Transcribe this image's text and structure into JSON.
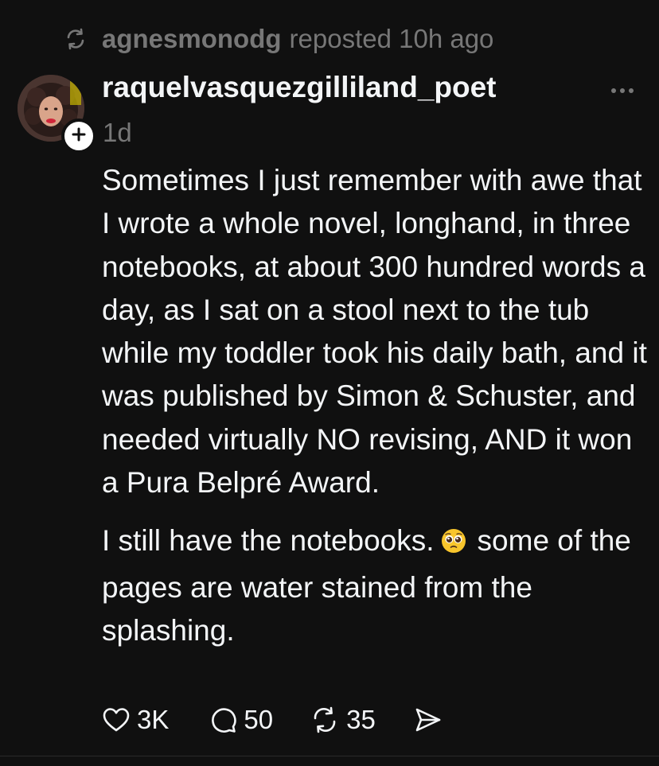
{
  "repost_header": {
    "reposter": "agnesmonodg",
    "text": "reposted 10h ago",
    "icon": "repost-icon"
  },
  "post": {
    "author": "raquelvasquezgilliland_poet",
    "time": "1d",
    "paragraphs": [
      "Sometimes I just remember with awe that I wrote a whole novel, longhand, in three notebooks, at about 300 hundred words a day, as I sat on a stool next to the tub while my toddler took his daily bath, and it was published by Simon & Schuster, and needed virtually NO revising, AND it won a Pura Belpré Award."
    ],
    "paragraph2_before_emoji": "I still have the notebooks.",
    "paragraph2_emoji": "pleading-face-emoji",
    "paragraph2_after_emoji": "some of the pages are water stained from the splashing."
  },
  "actions": {
    "likes": "3K",
    "replies": "50",
    "reposts": "35"
  },
  "icons": {
    "like": "heart-icon",
    "reply": "comment-icon",
    "repost": "repost-icon",
    "share": "send-icon",
    "more": "more-options-icon",
    "follow": "plus-icon"
  },
  "colors": {
    "background": "#101010",
    "text": "#f3f5f7",
    "secondary_text": "#777777"
  }
}
